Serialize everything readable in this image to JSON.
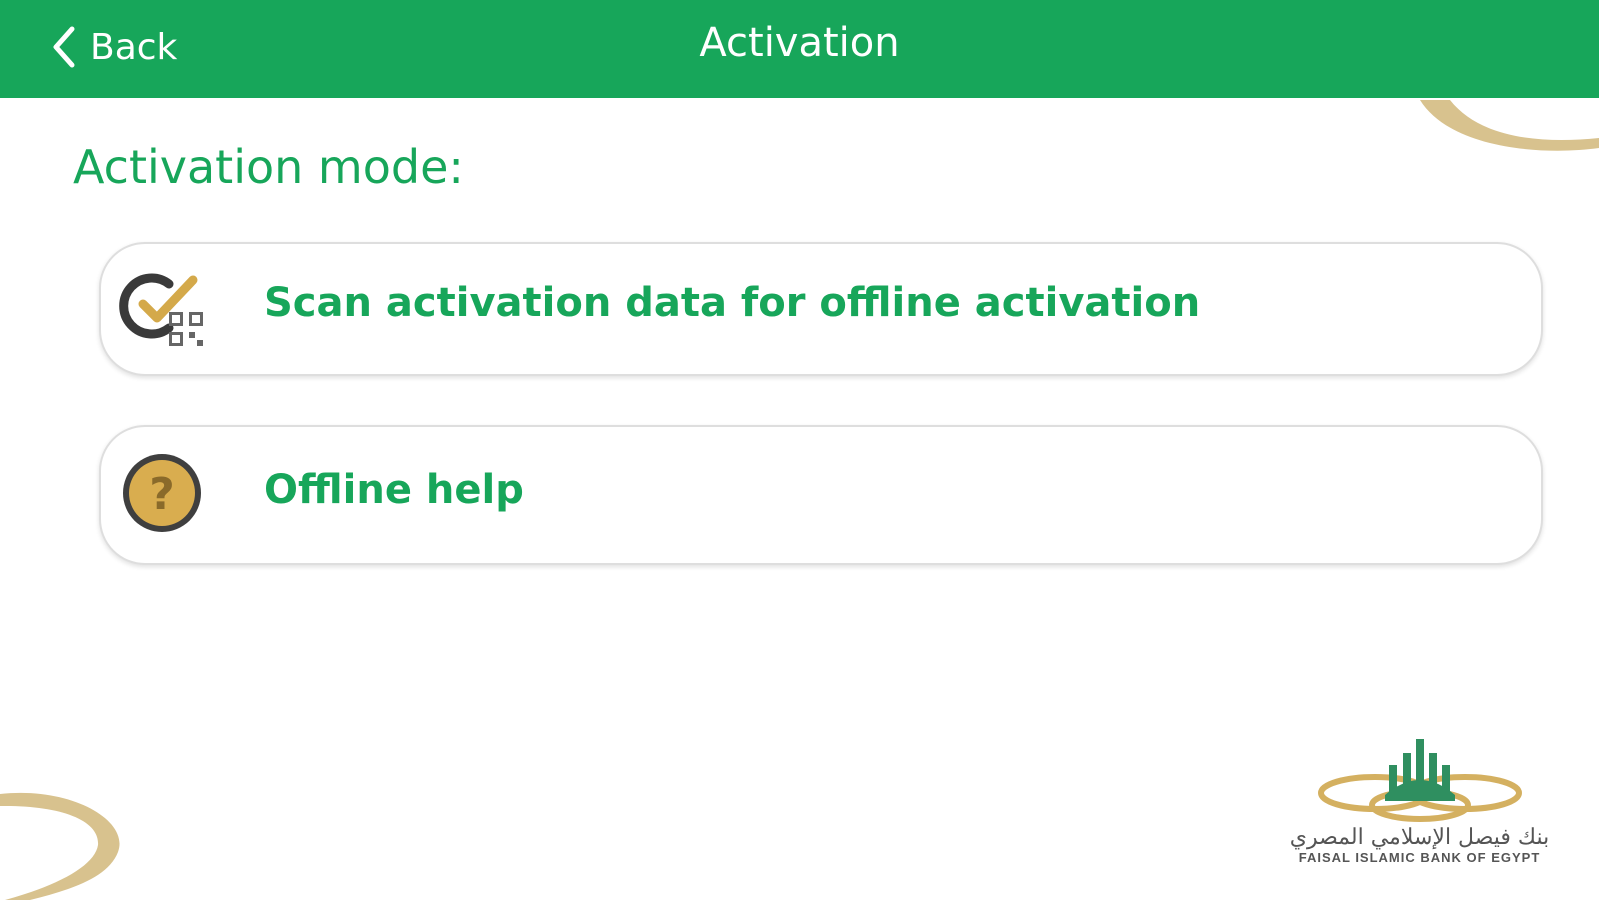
{
  "header": {
    "back_label": "Back",
    "title": "Activation"
  },
  "main": {
    "heading": "Activation mode:",
    "options": [
      {
        "label": "Scan activation data for offline activation",
        "icon": "qr-check-icon"
      },
      {
        "label": "Offline help",
        "icon": "help-icon"
      }
    ]
  },
  "logo": {
    "arabic_text": "بنك فيصل الإسلامي المصري",
    "english_text": "FAISAL ISLAMIC BANK OF EGYPT"
  },
  "colors": {
    "brand_green": "#17a65a",
    "gold": "#d4b060",
    "border": "#dedede"
  }
}
